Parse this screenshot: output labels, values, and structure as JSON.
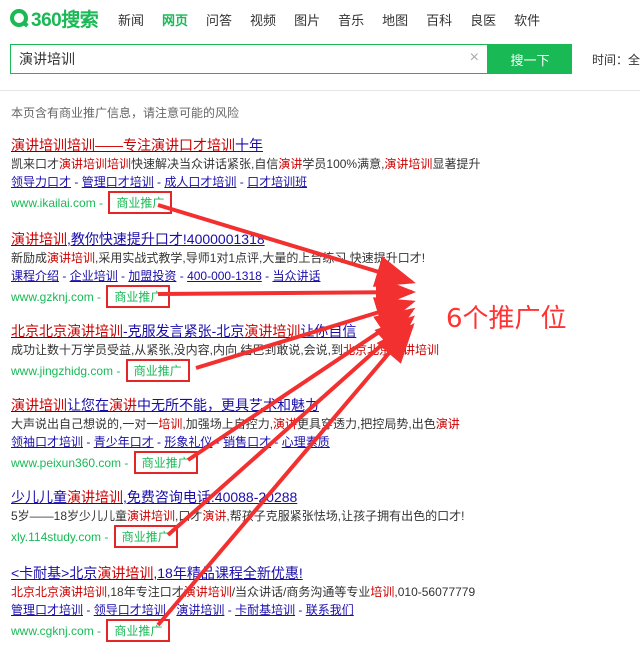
{
  "brand": {
    "logo_text": "360搜索"
  },
  "nav": [
    "新闻",
    "网页",
    "问答",
    "视频",
    "图片",
    "音乐",
    "地图",
    "百科",
    "良医",
    "软件"
  ],
  "nav_active": "网页",
  "search": {
    "value": "演讲培训",
    "button": "搜一下",
    "clear": "×"
  },
  "time_filter": "时间：全",
  "notice": "本页含有商业推广信息，请注意可能的风险",
  "ad_label": "商业推广",
  "annotation": "6个推广位",
  "colors": {
    "accent": "#19b955",
    "link": "#1a0dab",
    "highlight": "#cc0000",
    "annotation_red": "#e32626"
  },
  "results": [
    {
      "title": [
        {
          "t": "演讲培训"
        },
        {
          "t": "培训——专注"
        },
        {
          "t": "演讲口才"
        },
        {
          "t": "培训"
        },
        {
          "t": "十年"
        }
      ],
      "desc": [
        {
          "t": "凯来口才"
        },
        {
          "t": "演讲培训培训",
          "h": true
        },
        {
          "t": "快速解决当众讲话紧张,自信"
        },
        {
          "t": "演讲",
          "h": true
        },
        {
          "t": "学员100%满意,"
        },
        {
          "t": "演讲培训",
          "h": true
        },
        {
          "t": "显著提升"
        }
      ],
      "links": [
        "领导力口才",
        "管理口才培训",
        "成人口才培训",
        "口才培训班"
      ],
      "url": "www.ikailai.com"
    },
    {
      "title": [
        {
          "t": "演讲培训"
        },
        {
          "t": ",教你快速提升口才!4000001318"
        }
      ],
      "desc": [
        {
          "t": "新励成"
        },
        {
          "t": "演讲培训",
          "h": true
        },
        {
          "t": ",采用实战式教学,导师1对1点评,大量的上台练习,快速提升口才!"
        }
      ],
      "links": [
        "课程介绍",
        "企业培训",
        "加盟投资",
        "400-000-1318",
        "当众讲话"
      ],
      "url": "www.gzknj.com"
    },
    {
      "title": [
        {
          "t": "北京北京演讲培训"
        },
        {
          "t": "-克服发言紧张-北京"
        },
        {
          "t": "演讲培训"
        },
        {
          "t": "让你自信"
        }
      ],
      "desc": [
        {
          "t": "成功让数十万学员受益,从紧张,没内容,内向,结巴到敢说,会说,到"
        },
        {
          "t": "北京北京演讲培训",
          "h": true
        }
      ],
      "links": [],
      "url": "www.jingzhidg.com"
    },
    {
      "title": [
        {
          "t": "演讲培训"
        },
        {
          "t": "让您在"
        },
        {
          "t": "演讲"
        },
        {
          "t": "中无所不能，更具艺术和魅力"
        }
      ],
      "desc": [
        {
          "t": "大声说出自己想说的,一对一"
        },
        {
          "t": "培训",
          "h": true
        },
        {
          "t": ",加强场上自控力,"
        },
        {
          "t": "演讲",
          "h": true
        },
        {
          "t": "更具穿透力,把控局势,出色"
        },
        {
          "t": "演讲",
          "h": true
        }
      ],
      "links": [
        "领袖口才培训",
        "青少年口才",
        "形象礼仪",
        "销售口才",
        "心理素质"
      ],
      "url": "www.peixun360.com"
    },
    {
      "title": [
        {
          "t": "少儿儿童"
        },
        {
          "t": "演讲培训"
        },
        {
          "t": ",免费咨询电话:40088-20288"
        }
      ],
      "desc": [
        {
          "t": "5岁——18岁少儿儿童"
        },
        {
          "t": "演讲培训",
          "h": true
        },
        {
          "t": ",口才"
        },
        {
          "t": "演讲",
          "h": true
        },
        {
          "t": ",帮孩子克服紧张怯场,让孩子拥有出色的口才!"
        }
      ],
      "links": [],
      "url": "xly.114study.com"
    },
    {
      "title": [
        {
          "t": "<卡耐基>北京"
        },
        {
          "t": "演讲培训"
        },
        {
          "t": ",18年精品课程全新优惠!"
        }
      ],
      "desc": [
        {
          "t": "北京北京演讲培训",
          "h": true
        },
        {
          "t": ",18年专注口才"
        },
        {
          "t": "演讲培训",
          "h": true
        },
        {
          "t": "/当众讲话/商务沟通等专业"
        },
        {
          "t": "培训",
          "h": true
        },
        {
          "t": ",010-56077779"
        }
      ],
      "links": [
        "管理口才培训",
        "领导口才培训",
        "演讲培训",
        "卡耐基培训",
        "联系我们"
      ],
      "url": "www.cgknj.com"
    }
  ]
}
